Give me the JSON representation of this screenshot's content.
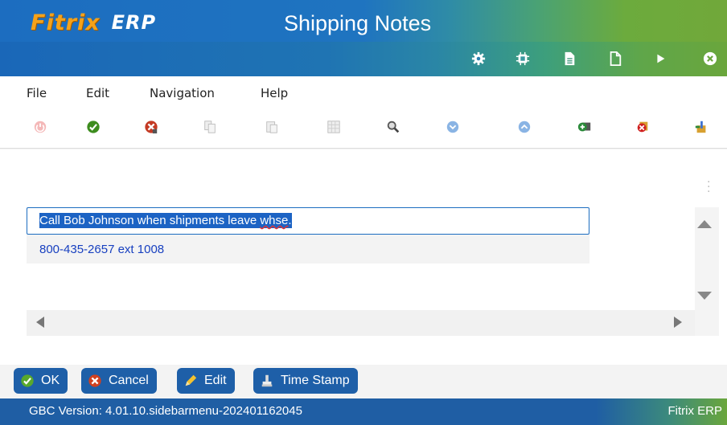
{
  "header": {
    "logo_brand": "Fitrix",
    "logo_suffix": "ERP",
    "title": "Shipping Notes",
    "icons": [
      "settings-icon",
      "chip-icon",
      "document-icon",
      "new-page-icon",
      "play-icon",
      "close-circle-icon"
    ]
  },
  "menu": {
    "file": "File",
    "edit": "Edit",
    "navigation": "Navigation",
    "help": "Help"
  },
  "toolbar": {
    "icons": [
      "power-icon",
      "accept-check-icon",
      "cancel-x-icon",
      "copy-icon",
      "paste-icon",
      "grid-icon",
      "zoom-icon",
      "down-circle-icon",
      "up-circle-icon",
      "add-row-icon",
      "delete-row-icon",
      "insert-icon"
    ]
  },
  "notes": {
    "line1": "Call Bob Johnson when shipments leave ",
    "line1_flagged": "whse",
    "line1_end": ".",
    "line2": "800-435-2657 ext 1008"
  },
  "buttons": {
    "ok": "OK",
    "cancel": "Cancel",
    "edit": "Edit",
    "timestamp": "Time Stamp"
  },
  "status": {
    "version": "GBC Version: 4.01.10.sidebarmenu-202401162045",
    "app": "Fitrix ERP"
  },
  "colors": {
    "primary": "#1e5fa8",
    "selection": "#1c63c4",
    "accent_orange": "#f5a21a",
    "green": "#6aa63c"
  }
}
